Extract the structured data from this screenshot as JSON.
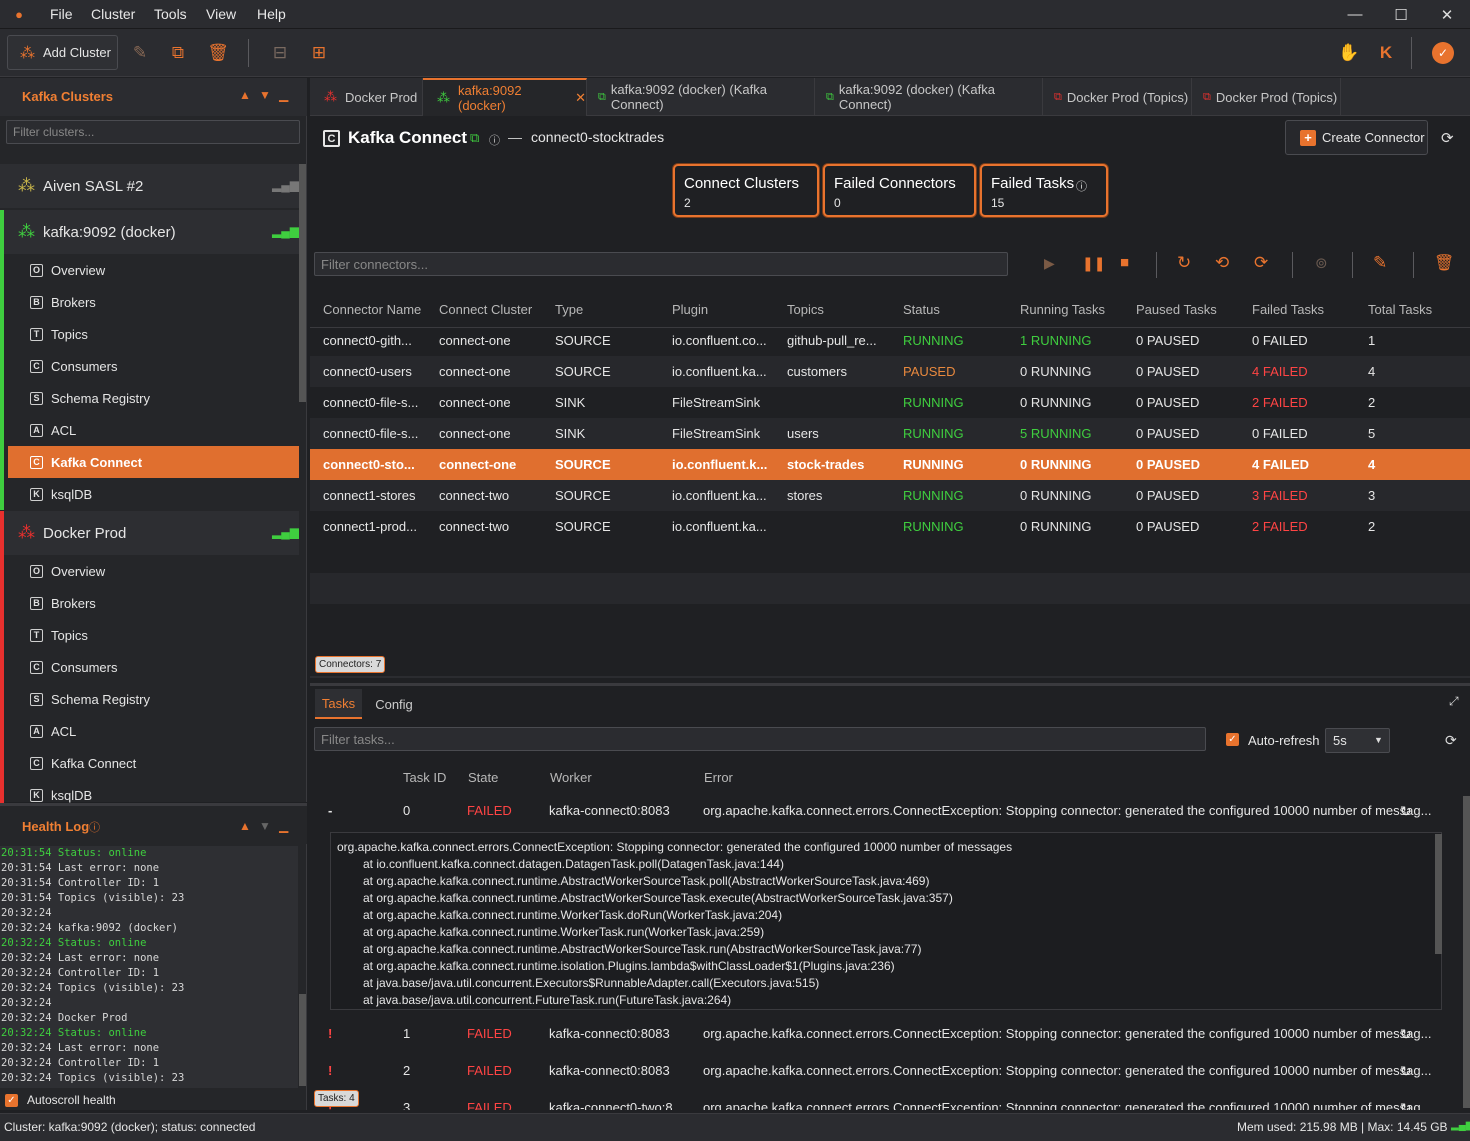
{
  "titlebar": {
    "menu": [
      "File",
      "Cluster",
      "Tools",
      "View",
      "Help"
    ]
  },
  "toolbar": {
    "add_cluster": "Add Cluster"
  },
  "clusters_panel": {
    "title": "Kafka Clusters",
    "filter_placeholder": "Filter clusters..."
  },
  "clusters": [
    {
      "name": "Aiven SASL #2"
    },
    {
      "name": "kafka:9092 (docker)",
      "items": [
        {
          "box": "O",
          "label": "Overview"
        },
        {
          "box": "B",
          "label": "Brokers"
        },
        {
          "box": "T",
          "label": "Topics"
        },
        {
          "box": "C",
          "label": "Consumers"
        },
        {
          "box": "S",
          "label": "Schema Registry"
        },
        {
          "box": "A",
          "label": "ACL"
        },
        {
          "box": "C",
          "label": "Kafka Connect"
        },
        {
          "box": "K",
          "label": "ksqlDB"
        }
      ]
    },
    {
      "name": "Docker Prod",
      "items": [
        {
          "box": "O",
          "label": "Overview"
        },
        {
          "box": "B",
          "label": "Brokers"
        },
        {
          "box": "T",
          "label": "Topics"
        },
        {
          "box": "C",
          "label": "Consumers"
        },
        {
          "box": "S",
          "label": "Schema Registry"
        },
        {
          "box": "A",
          "label": "ACL"
        },
        {
          "box": "C",
          "label": "Kafka Connect"
        },
        {
          "box": "K",
          "label": "ksqlDB"
        }
      ]
    }
  ],
  "health": {
    "title": "Health Log",
    "autoscroll": "Autoscroll health",
    "lines": [
      {
        "t": "20:31:54 Status: online",
        "ok": true
      },
      {
        "t": "20:31:54 Last error: none"
      },
      {
        "t": "20:31:54 Controller ID: 1"
      },
      {
        "t": "20:31:54 Topics (visible): 23"
      },
      {
        "t": "20:32:24"
      },
      {
        "t": "20:32:24 kafka:9092 (docker)"
      },
      {
        "t": "20:32:24 Status: online",
        "ok": true
      },
      {
        "t": "20:32:24 Last error: none"
      },
      {
        "t": "20:32:24 Controller ID: 1"
      },
      {
        "t": "20:32:24 Topics (visible): 23"
      },
      {
        "t": "20:32:24"
      },
      {
        "t": "20:32:24 Docker Prod"
      },
      {
        "t": "20:32:24 Status: online",
        "ok": true
      },
      {
        "t": "20:32:24 Last error: none"
      },
      {
        "t": "20:32:24 Controller ID: 1"
      },
      {
        "t": "20:32:24 Topics (visible): 23"
      }
    ]
  },
  "tabs": [
    "Docker Prod",
    "kafka:9092 (docker)",
    "kafka:9092 (docker) (Kafka Connect)",
    "kafka:9092 (docker) (Kafka Connect)",
    "Docker Prod (Topics)",
    "Docker Prod (Topics)"
  ],
  "header": {
    "title": "Kafka Connect",
    "dash": "—",
    "connector": "connect0-stocktrades",
    "create_connector": "Create Connector"
  },
  "cards": [
    {
      "title": "Connect Clusters",
      "value": "2"
    },
    {
      "title": "Failed Connectors",
      "value": "0"
    },
    {
      "title": "Failed Tasks",
      "value": "15"
    }
  ],
  "filter_connectors": "Filter connectors...",
  "columns": [
    "Connector Name",
    "Connect Cluster",
    "Type",
    "Plugin",
    "Topics",
    "Status",
    "Running Tasks",
    "Paused Tasks",
    "Failed Tasks",
    "Total Tasks"
  ],
  "rows": [
    [
      "connect0-gith...",
      "connect-one",
      "SOURCE",
      "io.confluent.co...",
      "github-pull_re...",
      "RUNNING",
      "1 RUNNING",
      "0 PAUSED",
      "0 FAILED",
      "1"
    ],
    [
      "connect0-users",
      "connect-one",
      "SOURCE",
      "io.confluent.ka...",
      "customers",
      "PAUSED",
      "0 RUNNING",
      "0 PAUSED",
      "4 FAILED",
      "4"
    ],
    [
      "connect0-file-s...",
      "connect-one",
      "SINK",
      "FileStreamSink",
      "",
      "RUNNING",
      "0 RUNNING",
      "0 PAUSED",
      "2 FAILED",
      "2"
    ],
    [
      "connect0-file-s...",
      "connect-one",
      "SINK",
      "FileStreamSink",
      "users",
      "RUNNING",
      "5 RUNNING",
      "0 PAUSED",
      "0 FAILED",
      "5"
    ],
    [
      "connect0-sto...",
      "connect-one",
      "SOURCE",
      "io.confluent.k...",
      "stock-trades",
      "RUNNING",
      "0 RUNNING",
      "0 PAUSED",
      "4 FAILED",
      "4"
    ],
    [
      "connect1-stores",
      "connect-two",
      "SOURCE",
      "io.confluent.ka...",
      "stores",
      "RUNNING",
      "0 RUNNING",
      "0 PAUSED",
      "3 FAILED",
      "3"
    ],
    [
      "connect1-prod...",
      "connect-two",
      "SOURCE",
      "io.confluent.ka...",
      "",
      "RUNNING",
      "0 RUNNING",
      "0 PAUSED",
      "2 FAILED",
      "2"
    ]
  ],
  "connectors_count": "Connectors: 7",
  "bottom": {
    "tabs": [
      "Tasks",
      "Config"
    ],
    "filter_tasks": "Filter tasks...",
    "autorefresh": "Auto-refresh",
    "interval": "5s",
    "columns": [
      "Task ID",
      "State",
      "Worker",
      "Error"
    ],
    "tasks": [
      {
        "mark": "-",
        "id": "0",
        "state": "FAILED",
        "worker": "kafka-connect0:8083",
        "error": "org.apache.kafka.connect.errors.ConnectException: Stopping connector: generated the configured 10000 number of messag..."
      },
      {
        "mark": "!",
        "id": "1",
        "state": "FAILED",
        "worker": "kafka-connect0:8083",
        "error": "org.apache.kafka.connect.errors.ConnectException: Stopping connector: generated the configured 10000 number of messag..."
      },
      {
        "mark": "!",
        "id": "2",
        "state": "FAILED",
        "worker": "kafka-connect0:8083",
        "error": "org.apache.kafka.connect.errors.ConnectException: Stopping connector: generated the configured 10000 number of messag..."
      },
      {
        "mark": "!",
        "id": "3",
        "state": "FAILED",
        "worker": "kafka-connect0-two:8...",
        "error": "org.apache.kafka.connect.errors.ConnectException: Stopping connector: generated the configured 10000 number of messag..."
      }
    ],
    "trace": [
      "org.apache.kafka.connect.errors.ConnectException: Stopping connector: generated the configured 10000 number of messages",
      "at io.confluent.kafka.connect.datagen.DatagenTask.poll(DatagenTask.java:144)",
      "at org.apache.kafka.connect.runtime.AbstractWorkerSourceTask.poll(AbstractWorkerSourceTask.java:469)",
      "at org.apache.kafka.connect.runtime.AbstractWorkerSourceTask.execute(AbstractWorkerSourceTask.java:357)",
      "at org.apache.kafka.connect.runtime.WorkerTask.doRun(WorkerTask.java:204)",
      "at org.apache.kafka.connect.runtime.WorkerTask.run(WorkerTask.java:259)",
      "at org.apache.kafka.connect.runtime.AbstractWorkerSourceTask.run(AbstractWorkerSourceTask.java:77)",
      "at org.apache.kafka.connect.runtime.isolation.Plugins.lambda$withClassLoader$1(Plugins.java:236)",
      "at java.base/java.util.concurrent.Executors$RunnableAdapter.call(Executors.java:515)",
      "at java.base/java.util.concurrent.FutureTask.run(FutureTask.java:264)"
    ],
    "tasks_count": "Tasks: 4"
  },
  "status": {
    "left": "Cluster: kafka:9092 (docker); status: connected",
    "right": "Mem used: 215.98 MB | Max: 14.45 GB"
  },
  "colors": {
    "accent": "#e8732e",
    "running": "#3fce3f",
    "paused": "#e8893e",
    "failed": "#ff4444"
  }
}
